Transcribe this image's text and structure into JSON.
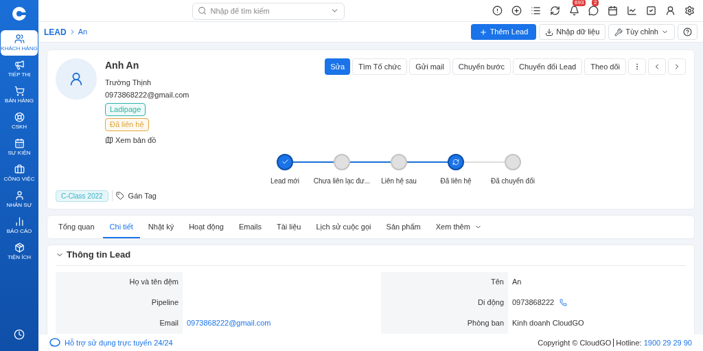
{
  "sidebar": {
    "items": [
      {
        "label": "KHÁCH HÀNG",
        "selected": true
      },
      {
        "label": "TIẾP THỊ",
        "selected": false
      },
      {
        "label": "BÁN HÀNG",
        "selected": false
      },
      {
        "label": "CSKH",
        "selected": false
      },
      {
        "label": "SỰ KIỆN",
        "selected": false
      },
      {
        "label": "CÔNG VIỆC",
        "selected": false
      },
      {
        "label": "NHÂN SỰ",
        "selected": false
      },
      {
        "label": "BÁO CÁO",
        "selected": false
      },
      {
        "label": "TIỆN ÍCH",
        "selected": false
      }
    ]
  },
  "search": {
    "placeholder": "Nhập để tìm kiếm"
  },
  "notifications": {
    "bell_badge": "693",
    "chat_badge": "2"
  },
  "breadcrumb": {
    "root": "LEAD",
    "current": "An"
  },
  "actions": [
    {
      "label": "Thêm Lead",
      "kind": "primary"
    },
    {
      "label": "Nhập dữ liệu",
      "kind": "import"
    },
    {
      "label": "Tùy chỉnh",
      "kind": "dropdown"
    }
  ],
  "lead": {
    "name": "Anh An",
    "company": "Trường Thịnh",
    "email": "0973868222@gmail.com",
    "tags": [
      {
        "label": "Ladipage",
        "color": "#2bb5a8"
      },
      {
        "label": "Đã liên hệ",
        "color": "#e0a63a"
      }
    ],
    "map_link": "Xem bản đồ",
    "class_tag": "C-Class 2022",
    "assign_tag": "Gán Tag"
  },
  "buttons": [
    {
      "label": "Sửa",
      "selected": true
    },
    {
      "label": "Tìm Tổ chức",
      "selected": false
    },
    {
      "label": "Gửi mail",
      "selected": false
    },
    {
      "label": "Chuyển bước",
      "selected": false
    },
    {
      "label": "Chuyển đổi Lead",
      "selected": false
    },
    {
      "label": "Theo dõi",
      "selected": false
    }
  ],
  "stages": [
    {
      "label": "Lead mới",
      "kind": "done"
    },
    {
      "label": "Chưa liên lạc đư...",
      "kind": "passed"
    },
    {
      "label": "Liên hệ sau",
      "kind": "passed"
    },
    {
      "label": "Đã liên hệ",
      "kind": "current"
    },
    {
      "label": "Đã chuyển đổi",
      "kind": "pending"
    }
  ],
  "tabs": [
    {
      "label": "Tổng quan",
      "selected": false
    },
    {
      "label": "Chi tiết",
      "selected": true
    },
    {
      "label": "Nhật ký",
      "selected": false
    },
    {
      "label": "Hoạt động",
      "selected": false
    },
    {
      "label": "Emails",
      "selected": false
    },
    {
      "label": "Tài liệu",
      "selected": false
    },
    {
      "label": "Lịch sử cuộc gọi",
      "selected": false
    },
    {
      "label": "Sản phẩm",
      "selected": false
    },
    {
      "label": "Xem thêm",
      "selected": false
    }
  ],
  "section": {
    "title": "Thông tin Lead",
    "expanded": true,
    "fields": [
      {
        "label": "Họ và tên đệm",
        "kind": "text"
      },
      {
        "label": "Tên",
        "value": "An",
        "kind": "text"
      },
      {
        "label": "Pipeline",
        "kind": "text"
      },
      {
        "label": "Di động",
        "value": "0973868222",
        "kind": "phone"
      },
      {
        "label": "Email",
        "value": "0973868222@gmail.com",
        "kind": "link"
      },
      {
        "label": "Phòng ban",
        "value": "Kinh doanh CloudGO",
        "kind": "text"
      }
    ]
  },
  "footer": {
    "support": "Hỗ trợ sử dụng trực tuyến 24/24",
    "copyright": "Copyright © CloudGO",
    "hotline_label": "Hotline:",
    "hotline": "1900 29 29 90"
  }
}
